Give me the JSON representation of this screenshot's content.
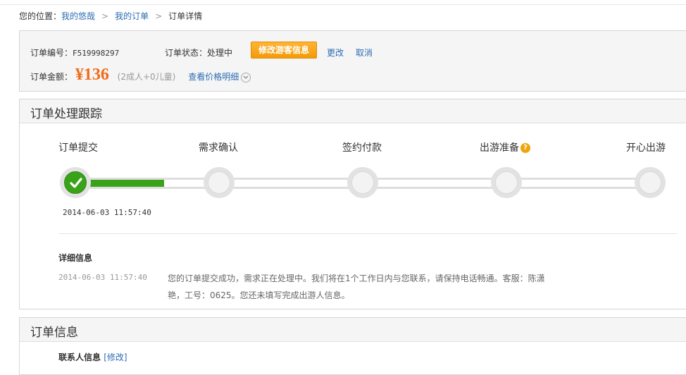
{
  "breadcrumb": {
    "prefix": "您的位置：",
    "items": [
      "我的悠哉",
      "我的订单",
      "订单详情"
    ],
    "separator": ">"
  },
  "summary": {
    "order_no_label": "订单编号：",
    "order_no": "F519998297",
    "status_label": "订单状态：",
    "status": "处理中",
    "modify_traveler_button": "修改游客信息",
    "change_link": "更改",
    "cancel_link": "取消",
    "amount_label": "订单金额：",
    "amount": "¥136",
    "people": "(2成人+0儿童)",
    "price_detail_link": "查看价格明细"
  },
  "tracker": {
    "title": "订单处理跟踪",
    "steps": [
      {
        "label": "订单提交",
        "done": true
      },
      {
        "label": "需求确认",
        "done": false
      },
      {
        "label": "签约付款",
        "done": false
      },
      {
        "label": "出游准备",
        "done": false,
        "help": true
      },
      {
        "label": "开心出游",
        "done": false
      }
    ],
    "progress_fraction": 0.17,
    "timestamp": "2014-06-03 11:57:40",
    "detail_title": "详细信息",
    "detail_time": "2014-06-03 11:57:40",
    "detail_text": "您的订单提交成功，需求正在处理中。我们将在1个工作日内与您联系，请保持电话畅通。客服：陈潇艳，工号：0625。您还未填写完成出游人信息。",
    "help_icon_glyph": "?"
  },
  "order_info": {
    "title": "订单信息",
    "contact_label": "联系人信息",
    "contact_edit": "[修改]"
  },
  "colors": {
    "accent_orange": "#f39a07",
    "amount_orange": "#f26b16",
    "progress_green": "#3aa219",
    "link_blue": "#2b6cb3"
  }
}
